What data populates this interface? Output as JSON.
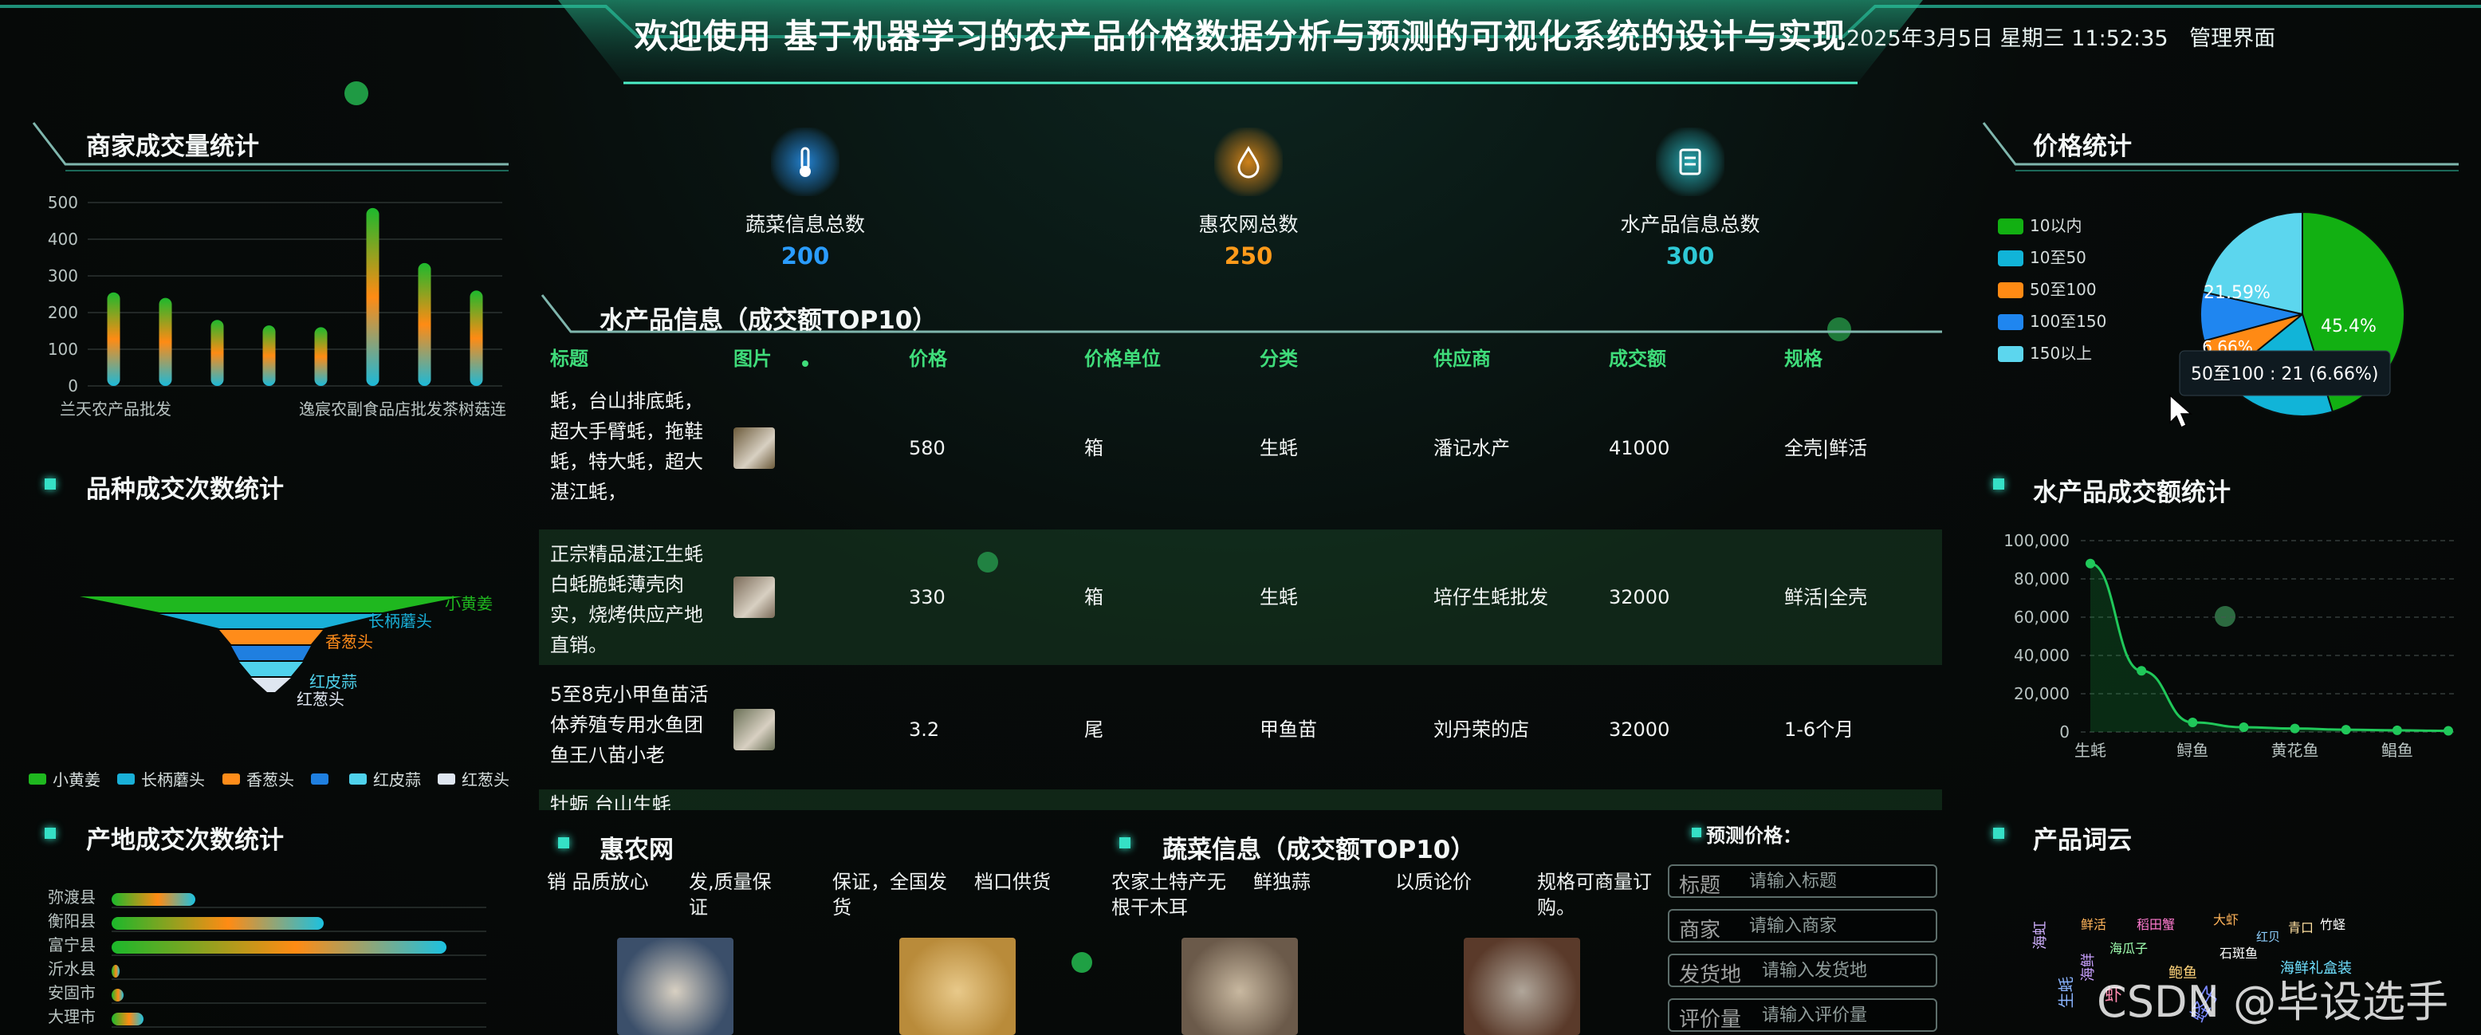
{
  "header": {
    "title": "欢迎使用 基于机器学习的农产品价格数据分析与预测的可视化系统的设计与实现",
    "datetime": "2025年3月5日 星期三 11:52:35",
    "admin_link": "管理界面"
  },
  "sections": {
    "merchant_volume": "商家成交量统计",
    "variety_count": "品种成交次数统计",
    "origin_count": "产地成交次数统计",
    "aquatic_top10": "水产品信息（成交额TOP10）",
    "huinong": "惠农网",
    "veg_top10": "蔬菜信息（成交额TOP10）",
    "price_stats": "价格统计",
    "aquatic_amount": "水产品成交额统计",
    "word_cloud": "产品词云"
  },
  "stats": [
    {
      "label": "蔬菜信息总数",
      "value": "200",
      "color": "#2a9cff",
      "icon": "thermometer-icon"
    },
    {
      "label": "惠农网总数",
      "value": "250",
      "color": "#ff9a1a",
      "icon": "droplet-icon"
    },
    {
      "label": "水产品信息总数",
      "value": "300",
      "color": "#2ec9d6",
      "icon": "clipboard-icon"
    }
  ],
  "merchant_chart": {
    "chart_data": {
      "type": "bar",
      "categories": [
        "兰天农产品批发",
        "",
        "",
        "",
        "",
        "逸宸农副食品店",
        "批发茶树菇",
        "连"
      ],
      "values": [
        255,
        240,
        180,
        165,
        160,
        485,
        335,
        260
      ],
      "ylim": [
        0,
        500
      ],
      "yticks": [
        "0",
        "100",
        "200",
        "300",
        "400",
        "500"
      ],
      "xlabels": [
        "兰天农产品批发",
        "逸宸农副食品店批发茶树菇连"
      ]
    }
  },
  "variety_chart": {
    "chart_data": {
      "type": "funnel",
      "series": [
        {
          "name": "小黄姜",
          "color": "#1fb81f"
        },
        {
          "name": "长柄蘑头",
          "color": "#19b0d8"
        },
        {
          "name": "香葱头",
          "color": "#ff8c1a"
        },
        {
          "name": "",
          "color": "#1f7fe0"
        },
        {
          "name": "红皮蒜",
          "color": "#4fd2ec"
        },
        {
          "name": "红葱头",
          "color": "#dfe6f0"
        }
      ],
      "labels": [
        "小黄姜",
        "长柄蘑头",
        "香葱头",
        "红皮蒜",
        "红葱头"
      ]
    }
  },
  "origin_chart": {
    "chart_data": {
      "type": "bar",
      "categories": [
        "弥渡县",
        "衡阳县",
        "富宁县",
        "沂水县",
        "安固市",
        "大理市"
      ],
      "values": [
        105,
        266,
        420,
        10,
        15,
        40
      ],
      "xlim": [
        0,
        470
      ]
    }
  },
  "aquatic_table": {
    "headers": [
      "标题",
      "图片",
      "价格",
      "价格单位",
      "分类",
      "供应商",
      "成交额",
      "规格"
    ],
    "rows": [
      {
        "title": [
          "蚝，台山排底蚝，",
          "超大手臂蚝，拖鞋",
          "蚝，特大蚝，超大",
          "湛江蚝，"
        ],
        "price": "580",
        "unit": "箱",
        "category": "生蚝",
        "supplier": "潘记水产",
        "amount": "41000",
        "spec": "全壳|鲜活"
      },
      {
        "title": [
          "正宗精品湛江生蚝",
          "白蚝脆蚝薄壳肉",
          "实，烧烤供应产地",
          "直销。"
        ],
        "price": "330",
        "unit": "箱",
        "category": "生蚝",
        "supplier": "培仔生蚝批发",
        "amount": "32000",
        "spec": "鲜活|全壳"
      },
      {
        "title": [
          "5至8克小甲鱼苗活",
          "体养殖专用水鱼团",
          "鱼王八苗小老"
        ],
        "price": "3.2",
        "unit": "尾",
        "category": "甲鱼苗",
        "supplier": "刘丹荣的店",
        "amount": "32000",
        "spec": "1-6个月"
      },
      {
        "title": [
          "牡蛎 台山生蚝"
        ],
        "price": "",
        "unit": "",
        "category": "",
        "supplier": "",
        "amount": "",
        "spec": ""
      }
    ]
  },
  "huinong": {
    "texts": [
      [
        "销 品质放心"
      ],
      [
        "发,质量保",
        "证"
      ],
      [
        "保证，全国发",
        "货"
      ],
      [
        "档口供货"
      ]
    ]
  },
  "veg": {
    "texts": [
      [
        "农家土特产无",
        "根干木耳"
      ],
      [
        "鲜独蒜"
      ],
      [
        "以质论价"
      ],
      [
        "规格可商量订",
        "购。"
      ]
    ]
  },
  "predict": {
    "title": "预测价格：",
    "fields": [
      {
        "label": "标题",
        "placeholder": "请输入标题"
      },
      {
        "label": "商家",
        "placeholder": "请输入商家"
      },
      {
        "label": "发货地",
        "placeholder": "请输入发货地"
      },
      {
        "label": "评价量",
        "placeholder": "请输入评价量"
      }
    ]
  },
  "price_chart": {
    "chart_data": {
      "type": "pie",
      "slices": [
        {
          "label": "10以内",
          "percent": 45.4,
          "color": "#12b012"
        },
        {
          "label": "10至50",
          "percent": 19.0,
          "color": "#11b4d8"
        },
        {
          "label": "50至100",
          "percent": 6.66,
          "color": "#ff8a14"
        },
        {
          "label": "100至150",
          "percent": 7.74,
          "color": "#1f86f0"
        },
        {
          "label": "150以上",
          "percent": 21.59,
          "color": "#5cd6ee"
        }
      ],
      "visible_labels": [
        "45.4%",
        "21.59%",
        "6.66%",
        "2"
      ],
      "tooltip": "50至100 : 21 (6.66%)"
    }
  },
  "aquatic_amount_chart": {
    "chart_data": {
      "type": "line",
      "x": [
        "生蚝",
        "",
        "鲟鱼",
        "",
        "黄花鱼",
        "",
        "鲳鱼",
        ""
      ],
      "xlabels": [
        "生蚝",
        "鲟鱼",
        "黄花鱼",
        "鲳鱼"
      ],
      "values": [
        88000,
        32000,
        5000,
        2500,
        1800,
        1200,
        900,
        600
      ],
      "ylim": [
        0,
        100000
      ],
      "yticks": [
        "0",
        "20,000",
        "40,000",
        "60,000",
        "80,000",
        "100,000"
      ]
    }
  },
  "word_cloud": {
    "words": [
      "鲜活",
      "稻田蟹",
      "红贝",
      "青口",
      "竹蛏",
      "海瓜子",
      "石斑鱼",
      "海鲜礼盒装",
      "海鲜",
      "鲍鱼",
      "生蚝",
      "虾",
      "蛏子",
      "海虹",
      "大虾"
    ]
  },
  "watermark": "CSDN @毕设选手"
}
